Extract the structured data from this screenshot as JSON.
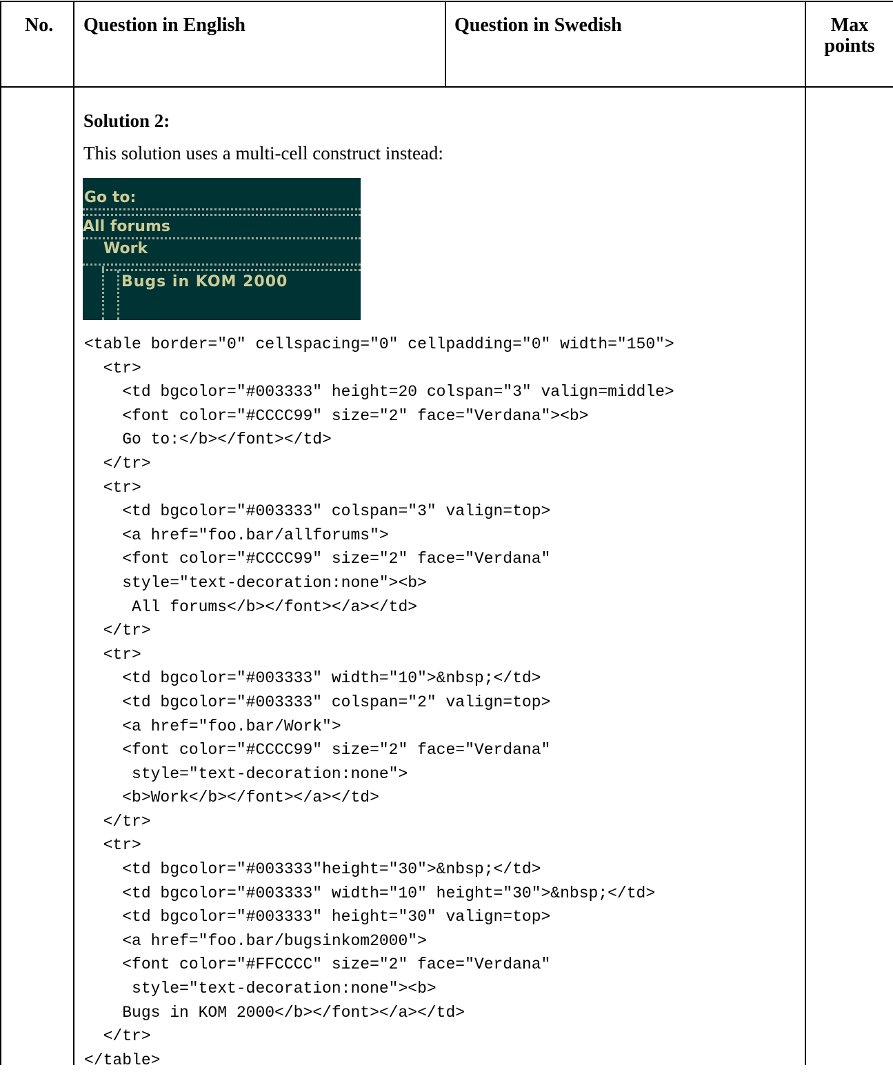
{
  "header": {
    "col_no": "No.",
    "col_english": "Question in English",
    "col_swedish": "Question in Swedish",
    "col_max_line1": "Max",
    "col_max_line2": "points"
  },
  "content": {
    "solution_title": "Solution 2:",
    "intro": "This solution uses a multi-cell construct instead:",
    "nav_image": {
      "goto": "Go to:",
      "all_forums": "All forums",
      "work": "Work",
      "bugs": "Bugs in KOM 2000",
      "background_color": "#003333",
      "text_color": "#CCCC99"
    },
    "code_lines": [
      "<table border=\"0\" cellspacing=\"0\" cellpadding=\"0\" width=\"150\">",
      "  <tr>",
      "    <td bgcolor=\"#003333\" height=20 colspan=\"3\" valign=middle>",
      "    <font color=\"#CCCC99\" size=\"2\" face=\"Verdana\"><b>",
      "    Go to:</b></font></td>",
      "  </tr>",
      "  <tr>",
      "    <td bgcolor=\"#003333\" colspan=\"3\" valign=top>",
      "    <a href=\"foo.bar/allforums\">",
      "    <font color=\"#CCCC99\" size=\"2\" face=\"Verdana\"",
      "    style=\"text-decoration:none\"><b>",
      "     All forums</b></font></a></td>",
      "  </tr>",
      "  <tr>",
      "    <td bgcolor=\"#003333\" width=\"10\">&nbsp;</td>",
      "    <td bgcolor=\"#003333\" colspan=\"2\" valign=top>",
      "    <a href=\"foo.bar/Work\">",
      "    <font color=\"#CCCC99\" size=\"2\" face=\"Verdana\"",
      "     style=\"text-decoration:none\">",
      "    <b>Work</b></font></a></td>",
      "  </tr>",
      "  <tr>",
      "    <td bgcolor=\"#003333\"height=\"30\">&nbsp;</td>",
      "    <td bgcolor=\"#003333\" width=\"10\" height=\"30\">&nbsp;</td>",
      "    <td bgcolor=\"#003333\" height=\"30\" valign=top>",
      "    <a href=\"foo.bar/bugsinkom2000\">",
      "    <font color=\"#FFCCCC\" size=\"2\" face=\"Verdana\"",
      "     style=\"text-decoration:none\"><b>",
      "    Bugs in KOM 2000</b></font></a></td>",
      "  </tr>",
      "</table>"
    ]
  }
}
